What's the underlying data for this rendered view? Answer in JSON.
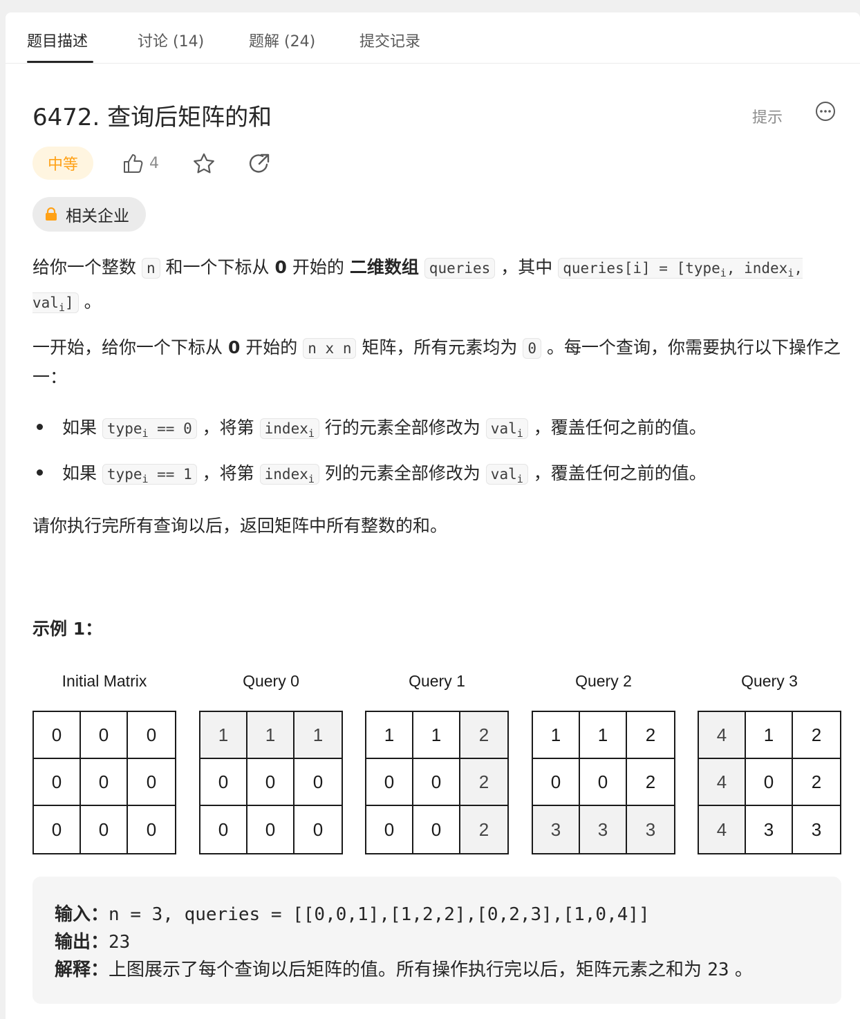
{
  "tabs": [
    {
      "label": "题目描述"
    },
    {
      "label": "讨论 (14)"
    },
    {
      "label": "题解 (24)"
    },
    {
      "label": "提交记录"
    }
  ],
  "problem": {
    "title": "6472. 查询后矩阵的和",
    "hint_label": "提示",
    "difficulty": "中等",
    "like_count": "4",
    "company_label": "相关企业"
  },
  "description": {
    "p1": {
      "t1": "给你一个整数 ",
      "c1": "n",
      "t2": " 和一个下标从 ",
      "b1": "0",
      "t3": " 开始的 ",
      "b2": "二维数组",
      "c2": "queries",
      "t4": " ，其中 ",
      "c3a": "queries[i] = [type",
      "sub1": "i",
      "c3b": ", index",
      "sub2": "i",
      "c3c": ", val",
      "sub3": "i",
      "c3d": "]",
      "t5": " 。"
    },
    "p2": {
      "t1": "一开始，给你一个下标从 ",
      "b1": "0",
      "t2": " 开始的 ",
      "c1": "n x n",
      "t3": " 矩阵，所有元素均为 ",
      "c2": "0",
      "t4": " 。每一个查询，你需要执行以下操作之一："
    },
    "bullets": [
      {
        "t1": "如果 ",
        "c1a": "type",
        "sub1": "i",
        "c1b": " == 0",
        "t2": " ，将第 ",
        "c2a": "index",
        "sub2": "i",
        "t3": " 行的元素全部修改为 ",
        "c3a": "val",
        "sub3": "i",
        "t4": " ，覆盖任何之前的值。"
      },
      {
        "t1": "如果 ",
        "c1a": "type",
        "sub1": "i",
        "c1b": " == 1",
        "t2": " ，将第 ",
        "c2a": "index",
        "sub2": "i",
        "t3": " 列的元素全部修改为 ",
        "c3a": "val",
        "sub3": "i",
        "t4": " ，覆盖任何之前的值。"
      }
    ],
    "p3": "请你执行完所有查询以后，返回矩阵中所有整数的和。"
  },
  "example": {
    "title": "示例 1：",
    "matrices": [
      {
        "label": "Initial Matrix",
        "cells": [
          "0",
          "0",
          "0",
          "0",
          "0",
          "0",
          "0",
          "0",
          "0"
        ],
        "highlighted": []
      },
      {
        "label": "Query 0",
        "cells": [
          "1",
          "1",
          "1",
          "0",
          "0",
          "0",
          "0",
          "0",
          "0"
        ],
        "highlighted": [
          0,
          1,
          2
        ]
      },
      {
        "label": "Query 1",
        "cells": [
          "1",
          "1",
          "2",
          "0",
          "0",
          "2",
          "0",
          "0",
          "2"
        ],
        "highlighted": [
          2,
          5,
          8
        ]
      },
      {
        "label": "Query 2",
        "cells": [
          "1",
          "1",
          "2",
          "0",
          "0",
          "2",
          "3",
          "3",
          "3"
        ],
        "highlighted": [
          6,
          7,
          8
        ]
      },
      {
        "label": "Query 3",
        "cells": [
          "4",
          "1",
          "2",
          "4",
          "0",
          "2",
          "4",
          "3",
          "3"
        ],
        "highlighted": [
          0,
          3,
          6
        ]
      }
    ],
    "input_key": "输入：",
    "input_val": "n = 3, queries = [[0,0,1],[1,2,2],[0,2,3],[1,0,4]]",
    "output_key": "输出：",
    "output_val": "23",
    "explain_key": "解释：",
    "explain_text": "上图展示了每个查询以后矩阵的值。所有操作执行完以后，矩阵元素之和为 ",
    "explain_num": "23",
    "explain_end": " 。"
  },
  "colors": {
    "accent_orange": "#ffa116",
    "difficulty_bg": "#fff5e0",
    "highlight_cell": "#f2f2f2"
  }
}
